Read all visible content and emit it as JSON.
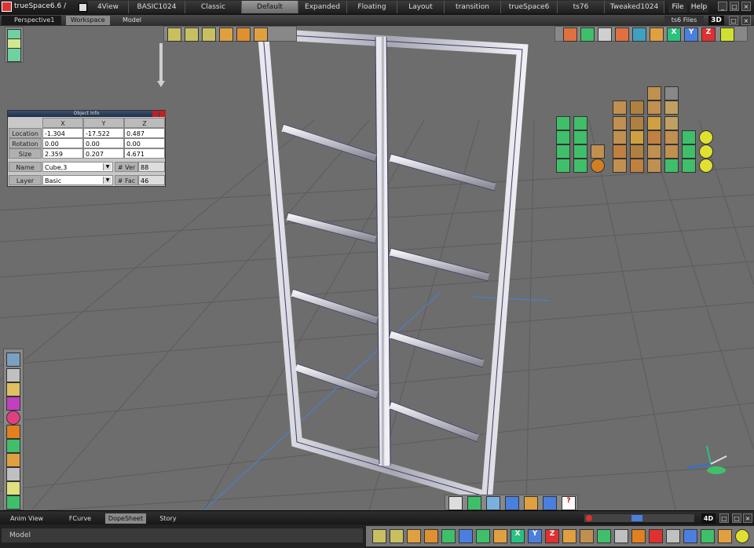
{
  "app": {
    "title": "trueSpace6.6 / ",
    "layouts": [
      "4View",
      "BASIC1024",
      "Classic",
      "Default",
      "Expanded",
      "Floating",
      "Layout",
      "transition",
      "trueSpace6",
      "ts76",
      "Tweaked1024"
    ],
    "active_layout": "Default",
    "menu": {
      "file": "File",
      "help": "Help"
    },
    "window_buttons": [
      "_",
      "□",
      "×"
    ]
  },
  "subbar": {
    "view_name": "Perspective1",
    "tabs": [
      "Workspace",
      "Model"
    ],
    "files_label": "ts6 Files",
    "mode": "3D"
  },
  "object_info": {
    "title": "Object Info",
    "columns": [
      "X",
      "Y",
      "Z"
    ],
    "rows": [
      {
        "label": "Location",
        "values": [
          "-1.304",
          "-17.522",
          "0.487"
        ]
      },
      {
        "label": "Rotation",
        "values": [
          "0.00",
          "0.00",
          "0.00"
        ]
      },
      {
        "label": "Size",
        "values": [
          "2.359",
          "0.207",
          "4.671"
        ]
      }
    ],
    "name_label": "Name",
    "name_value": "Cube,3",
    "layer_label": "Layer",
    "layer_value": "Basic",
    "vert_label": "# Ver",
    "vert_value": "88",
    "face_label": "# Fac",
    "face_value": "46"
  },
  "bottom": {
    "tabs": [
      "Anim View",
      "FCurve",
      "DopeSheet",
      "Story"
    ],
    "active_tab": "DopeSheet",
    "mode": "4D",
    "status": "Model"
  },
  "colors": {
    "axis_x": "#2a6fe0",
    "axis_y": "#2ac080",
    "axis_z": "#e03030",
    "frame": "#d4d4d8",
    "grid": "#5a5a5a"
  }
}
